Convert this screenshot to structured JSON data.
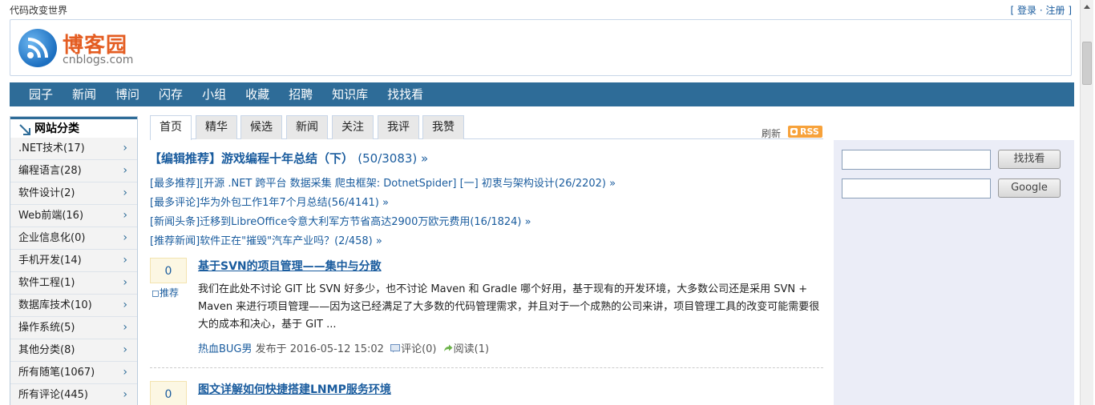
{
  "topbar": {
    "slogan": "代码改变世界",
    "login": "登录",
    "sep": "·",
    "register": "注册",
    "open_bracket": "[",
    "close_bracket": "]"
  },
  "logo": {
    "name_cn": "博客园",
    "name_en": "cnblogs.com"
  },
  "nav": [
    "园子",
    "新闻",
    "博问",
    "闪存",
    "小组",
    "收藏",
    "招聘",
    "知识库",
    "找找看"
  ],
  "sidebar": {
    "title": "网站分类",
    "chevron": "›",
    "items": [
      ".NET技术(17)",
      "编程语言(28)",
      "软件设计(2)",
      "Web前端(16)",
      "企业信息化(0)",
      "手机开发(14)",
      "软件工程(1)",
      "数据库技术(10)",
      "操作系统(5)",
      "其他分类(8)",
      "所有随笔(1067)",
      "所有评论(445)"
    ]
  },
  "tabs": [
    "首页",
    "精华",
    "候选",
    "新闻",
    "关注",
    "我评",
    "我赞"
  ],
  "refresh": "刷新",
  "rss": "RSS",
  "editor_pick": {
    "title": "【编辑推荐】游戏编程十年总结（下）",
    "count": "(50/3083) »"
  },
  "pick_lines": [
    "[最多推荐][开源 .NET 跨平台 数据采集 爬虫框架: DotnetSpider] [一] 初衷与架构设计(26/2202) »",
    "[最多评论]华为外包工作1年7个月总结(56/4141) »",
    "[新闻头条]迁移到LibreOffice令意大利军方节省高达2900万欧元费用(16/1824) »",
    "[推荐新闻]软件正在\"摧毁\"汽车产业吗？(2/458) »"
  ],
  "posts": [
    {
      "digg": "0",
      "recommend": "推荐",
      "title": "基于SVN的项目管理——集中与分散",
      "summary": "我们在此处不讨论 GIT 比 SVN 好多少，也不讨论 Maven 和 Gradle 哪个好用，基于现有的开发环境，大多数公司还是采用 SVN + Maven 来进行项目管理——因为这已经满足了大多数的代码管理需求，并且对于一个成熟的公司来讲，项目管理工具的改变可能需要很大的成本和决心，基于 GIT ...",
      "author": "热血BUG男",
      "published": "发布于 2016-05-12 15:02",
      "comments": "评论(0)",
      "reads": "阅读(1)"
    },
    {
      "digg": "0",
      "title": "图文详解如何快捷搭建LNMP服务环境"
    }
  ],
  "search": {
    "button": "找找看",
    "google": "Google"
  }
}
